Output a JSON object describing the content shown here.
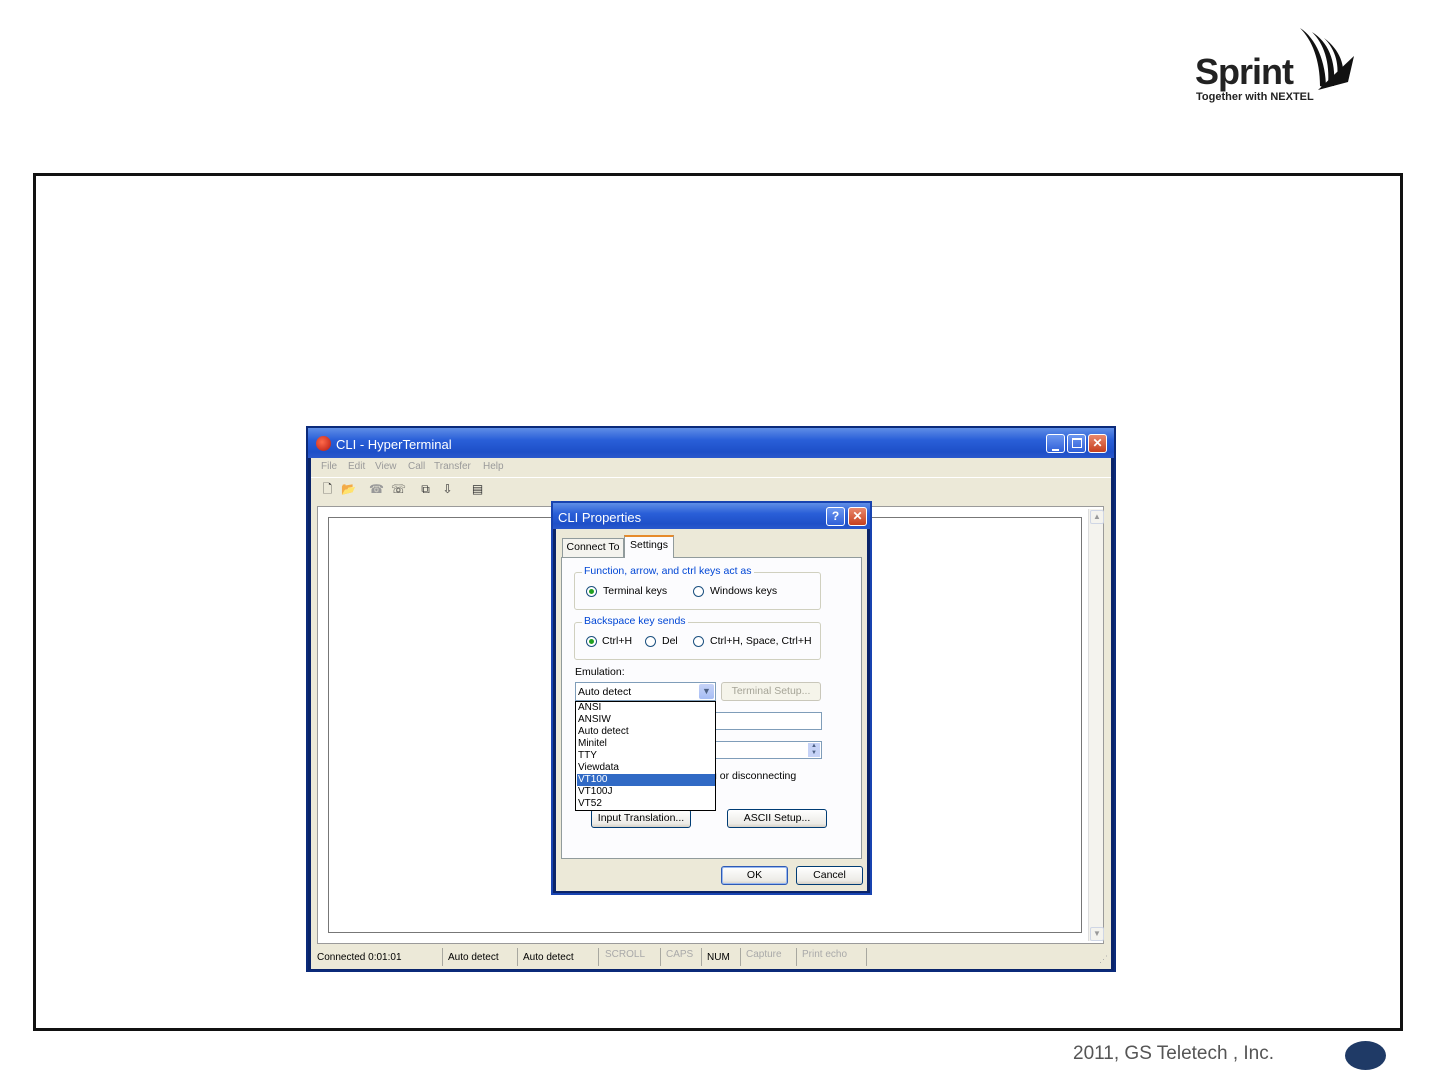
{
  "logo": {
    "brand": "Sprint",
    "tagline": "Together with NEXTEL"
  },
  "window": {
    "title": "CLI - HyperTerminal",
    "menu": [
      "File",
      "Edit",
      "View",
      "Call",
      "Transfer",
      "Help"
    ],
    "toolbar_icons": [
      "new-icon",
      "open-icon",
      "connect-icon",
      "disconnect-icon",
      "send-icon",
      "receive-icon",
      "properties-icon"
    ],
    "status": {
      "connected": "Connected 0:01:01",
      "emulation1": "Auto detect",
      "emulation2": "Auto detect",
      "scroll": "SCROLL",
      "caps": "CAPS",
      "num": "NUM",
      "capture": "Capture",
      "print_echo": "Print echo"
    }
  },
  "dialog": {
    "title": "CLI Properties",
    "tabs": {
      "connect": "Connect To",
      "settings": "Settings"
    },
    "keys_group": {
      "label": "Function, arrow, and ctrl keys act as",
      "terminal": "Terminal keys",
      "windows": "Windows keys"
    },
    "backspace_group": {
      "label": "Backspace key sends",
      "ctrlh": "Ctrl+H",
      "del": "Del",
      "combo": "Ctrl+H, Space, Ctrl+H"
    },
    "emulation_label": "Emulation:",
    "emulation_value": "Auto detect",
    "terminal_setup": "Terminal Setup...",
    "emulation_options": [
      "ANSI",
      "ANSIW",
      "Auto detect",
      "Minitel",
      "TTY",
      "Viewdata",
      "VT100",
      "VT100J",
      "VT52"
    ],
    "selected_option": "VT100",
    "partial_text": "g or disconnecting",
    "input_translation": "Input Translation...",
    "ascii_setup": "ASCII Setup...",
    "ok": "OK",
    "cancel": "Cancel"
  },
  "footer": {
    "copyright": "2011, GS Teletech , Inc."
  }
}
